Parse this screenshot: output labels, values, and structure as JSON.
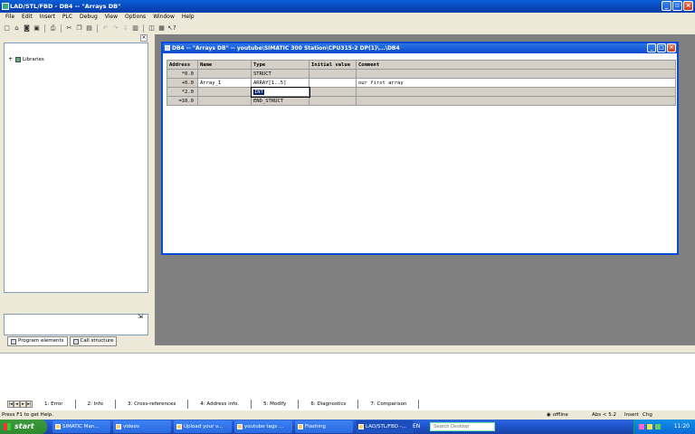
{
  "window": {
    "title": "LAD/STL/FBD  - DB4 -- \"Arrays DB\""
  },
  "menu": [
    "File",
    "Edit",
    "Insert",
    "PLC",
    "Debug",
    "View",
    "Options",
    "Window",
    "Help"
  ],
  "toolbar": {
    "icons": [
      "new-icon",
      "open-icon",
      "online-icon",
      "save-icon",
      "print-icon",
      "cut-icon",
      "copy-icon",
      "paste-icon",
      "undo-icon",
      "redo-icon",
      "download-icon",
      "monitor-icon",
      "overview-icon",
      "catalog-icon",
      "whats-this-icon"
    ]
  },
  "left_pane": {
    "close_glyph": "×",
    "tree": [
      {
        "label": "Libraries",
        "expander": "+"
      }
    ],
    "tabs": [
      "Program elements",
      "Call structure"
    ]
  },
  "db_window": {
    "title": "DB4 -- \"Arrays DB\" -- youtube\\SIMATIC 300 Station\\CPU315-2 DP(1)\\...\\DB4",
    "columns": [
      "Address",
      "Name",
      "Type",
      "Initial value",
      "Comment"
    ],
    "rows": [
      {
        "address": "*0.0",
        "name": "",
        "type": "STRUCT",
        "initial": "",
        "comment": ""
      },
      {
        "address": "+0.0",
        "name": "Array_1",
        "type": "ARRAY[1..5]",
        "initial": "",
        "comment": "our first array"
      },
      {
        "address": "*2.0",
        "name": "",
        "type": "INT",
        "initial": "",
        "comment": ""
      },
      {
        "address": "=10.0",
        "name": "",
        "type": "END_STRUCT",
        "initial": "",
        "comment": ""
      }
    ]
  },
  "output_tabs": [
    "1: Error",
    "2: Info",
    "3: Cross-references",
    "4: Address info.",
    "5: Modify",
    "6: Diagnostics",
    "7: Comparison"
  ],
  "status": {
    "help": "Press F1 to get Help.",
    "mode": "offline",
    "abs": "Abs < 5.2",
    "insert": "Insert",
    "chg": "Chg"
  },
  "taskbar": {
    "start": "start",
    "tasks": [
      "SIMATIC Man...",
      "videos",
      "Upload your v...",
      "youtube tags ...",
      "Flashing",
      "LAD/STL/FBD -..."
    ],
    "active_task": 5,
    "lang": "EN",
    "search_placeholder": "Search Desktop",
    "clock": "11:20"
  },
  "colors": {
    "titlebar": "#0a4ad0",
    "mdi_bg": "#808080",
    "taskbar": "#245edc",
    "start": "#3c9a3c"
  }
}
